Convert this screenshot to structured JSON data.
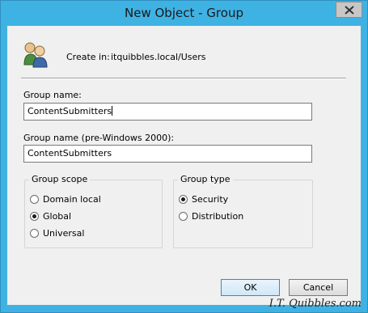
{
  "window": {
    "title": "New Object - Group",
    "close_label": "×"
  },
  "header": {
    "create_in_label": "Create in:",
    "create_in_path": "itquibbles.local/Users",
    "icon": "group-icon"
  },
  "fields": {
    "group_name_label": "Group name:",
    "group_name_value": "ContentSubmitters",
    "pre2000_label": "Group name (pre-Windows 2000):",
    "pre2000_value": "ContentSubmitters"
  },
  "scope": {
    "title": "Group scope",
    "options": [
      "Domain local",
      "Global",
      "Universal"
    ],
    "selected": "Global"
  },
  "type": {
    "title": "Group type",
    "options": [
      "Security",
      "Distribution"
    ],
    "selected": "Security"
  },
  "buttons": {
    "ok": "OK",
    "cancel": "Cancel"
  },
  "watermark": "I.T. Quibbles.com",
  "colors": {
    "frame": "#3fb2e4",
    "client": "#f0f0f0"
  }
}
